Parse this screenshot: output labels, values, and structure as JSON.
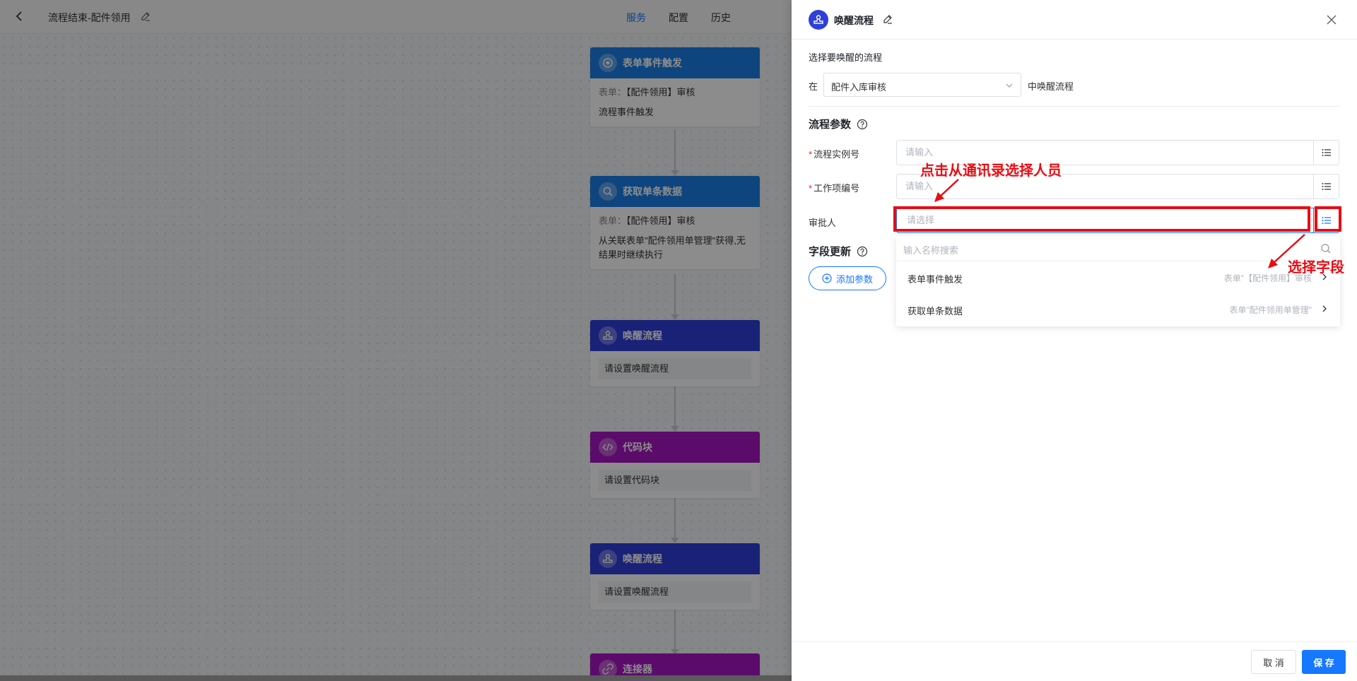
{
  "canvas": {
    "page_title": "流程结束-配件领用",
    "tabs": [
      {
        "label": "服务",
        "active": true
      },
      {
        "label": "配置",
        "active": false
      },
      {
        "label": "历史",
        "active": false
      }
    ],
    "nodes": [
      {
        "title": "表单事件触发",
        "color": "#1a7fe6",
        "form_label": "表单：",
        "form_value": "【配件领用】审核",
        "desc": "流程事件触发"
      },
      {
        "title": "获取单条数据",
        "color": "#1a7fe6",
        "form_label": "表单：",
        "form_value": "【配件领用】审核",
        "desc": "从关联表单\"配件领用单管理\"获得,无结果时继续执行"
      },
      {
        "title": "唤醒流程",
        "color": "#2f3fd9",
        "placeholder": "请设置唤醒流程"
      },
      {
        "title": "代码块",
        "color": "#a614c2",
        "placeholder": "请设置代码块"
      },
      {
        "title": "唤醒流程",
        "color": "#2f3fd9",
        "placeholder": "请设置唤醒流程"
      },
      {
        "title": "连接器",
        "color": "#a614c2"
      }
    ]
  },
  "drawer": {
    "title": "唤醒流程",
    "target_label": "选择要唤醒的流程",
    "in_label": "在",
    "process_select": {
      "value": "配件入库审核"
    },
    "in_suffix": "中唤醒流程",
    "params_title": "流程参数",
    "fields": [
      {
        "label": "流程实例号",
        "required": true,
        "placeholder": "请输入"
      },
      {
        "label": "工作项编号",
        "required": true,
        "placeholder": "请输入"
      },
      {
        "label": "审批人",
        "required": false,
        "placeholder": "请选择"
      }
    ],
    "update_title": "字段更新",
    "add_param_label": "添加参数",
    "dropdown": {
      "search_placeholder": "输入名称搜索",
      "items": [
        {
          "label": "表单事件触发",
          "detail": "表单\"【配件领用】审核"
        },
        {
          "label": "获取单条数据",
          "detail": "表单\"配件领用单管理\""
        }
      ]
    },
    "annotations": {
      "contacts": "点击从通讯录选择人员",
      "field": "选择字段"
    },
    "cancel_label": "取 消",
    "save_label": "保 存",
    "accent": "#1677ff",
    "highlight": "#ea0c12"
  }
}
